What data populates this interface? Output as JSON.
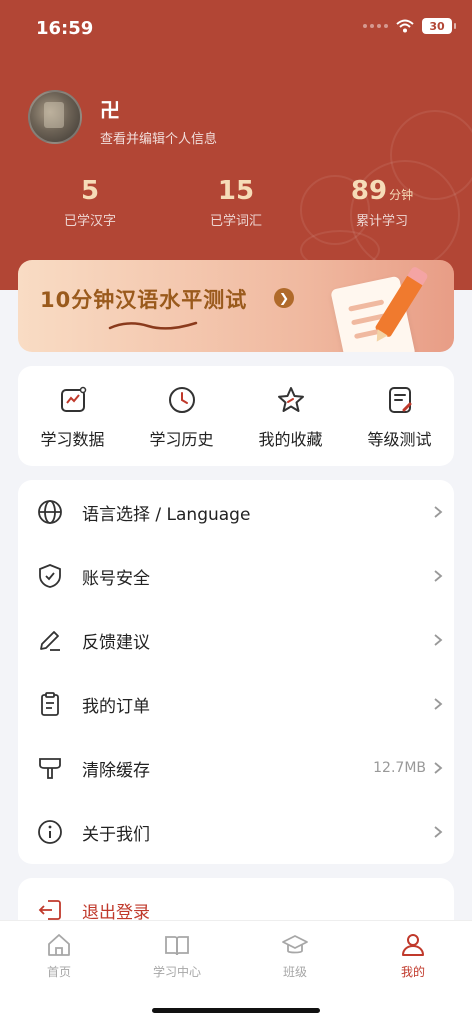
{
  "status_bar": {
    "time": "16:59",
    "battery": "30"
  },
  "profile": {
    "name": "卍",
    "edit_text": "查看并编辑个人信息"
  },
  "stats": [
    {
      "value": "5",
      "unit": "",
      "label": "已学汉字"
    },
    {
      "value": "15",
      "unit": "",
      "label": "已学词汇"
    },
    {
      "value": "89",
      "unit": "分钟",
      "label": "累计学习"
    }
  ],
  "banner": {
    "text": "10分钟汉语水平测试"
  },
  "quick_actions": [
    {
      "label": "学习数据",
      "icon": "chart-icon"
    },
    {
      "label": "学习历史",
      "icon": "clock-icon"
    },
    {
      "label": "我的收藏",
      "icon": "star-icon"
    },
    {
      "label": "等级测试",
      "icon": "test-icon"
    }
  ],
  "menu": [
    {
      "label": "语言选择 / Language",
      "icon": "globe-icon",
      "value": ""
    },
    {
      "label": "账号安全",
      "icon": "shield-icon",
      "value": ""
    },
    {
      "label": "反馈建议",
      "icon": "pencil-icon",
      "value": ""
    },
    {
      "label": "我的订单",
      "icon": "clipboard-icon",
      "value": ""
    },
    {
      "label": "清除缓存",
      "icon": "brush-icon",
      "value": "12.7MB"
    },
    {
      "label": "关于我们",
      "icon": "info-icon",
      "value": ""
    }
  ],
  "logout": {
    "label": "退出登录"
  },
  "tabs": [
    {
      "label": "首页",
      "icon": "home-icon"
    },
    {
      "label": "学习中心",
      "icon": "book-icon"
    },
    {
      "label": "班级",
      "icon": "graduation-cap-icon"
    },
    {
      "label": "我的",
      "icon": "user-icon",
      "active": true
    }
  ],
  "colors": {
    "brand": "#b24635",
    "accent_text": "#f6dcb8",
    "banner_text": "#9a5a1c",
    "logout": "#c0392b"
  }
}
